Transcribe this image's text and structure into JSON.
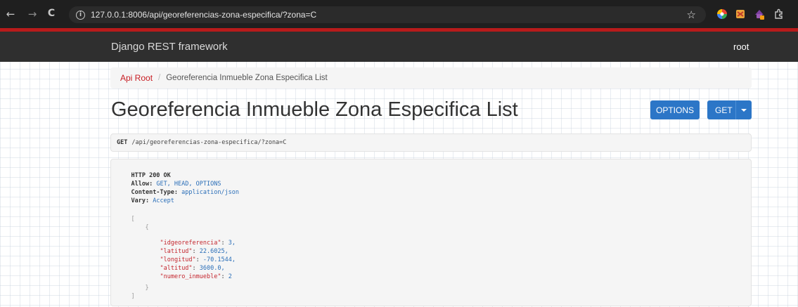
{
  "browser": {
    "url": "127.0.0.1:8006/api/georeferencias-zona-especifica/?zona=C",
    "back": "←",
    "forward": "→",
    "reload": "C",
    "info": "i",
    "star": "☆"
  },
  "navbar": {
    "brand": "Django REST framework",
    "user": "root"
  },
  "breadcrumb": {
    "root": "Api Root",
    "separator": "/",
    "current": "Georeferencia Inmueble Zona Especifica List"
  },
  "page_title": "Georeferencia Inmueble Zona Especifica List",
  "buttons": {
    "options": "OPTIONS",
    "get": "GET"
  },
  "request": {
    "method": "GET",
    "url": "/api/georeferencias-zona-especifica/?zona=C"
  },
  "response": {
    "status": "HTTP 200 OK",
    "headers": [
      {
        "key": "Allow:",
        "value": "GET, HEAD, OPTIONS"
      },
      {
        "key": "Content-Type:",
        "value": "application/json"
      },
      {
        "key": "Vary:",
        "value": "Accept"
      }
    ],
    "open_bracket": "[",
    "open_brace": "{",
    "fields": [
      {
        "key": "\"idgeoreferencia\"",
        "value": "3,"
      },
      {
        "key": "\"latitud\"",
        "value": "22.6025,"
      },
      {
        "key": "\"longitud\"",
        "value": "-70.1544,"
      },
      {
        "key": "\"altitud\"",
        "value": "3600.0,"
      },
      {
        "key": "\"numero_inmueble\"",
        "value": "2"
      }
    ],
    "close_brace": "}",
    "close_bracket": "]"
  },
  "colors": {
    "accent_red": "#b81b1b",
    "button_blue": "#2c76c7",
    "link_red": "#c71c22"
  }
}
